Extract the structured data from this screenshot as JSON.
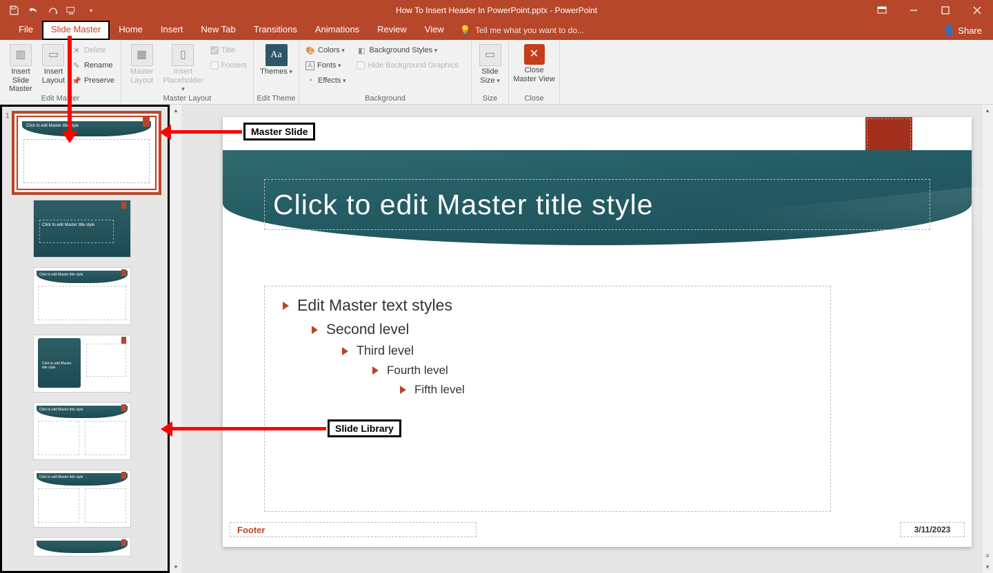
{
  "title": "How To Insert Header In PowerPoint.pptx - PowerPoint",
  "tabs": {
    "file": "File",
    "slide_master": "Slide Master",
    "home": "Home",
    "insert": "Insert",
    "new_tab": "New Tab",
    "transitions": "Transitions",
    "animations": "Animations",
    "review": "Review",
    "view": "View",
    "tellme": "Tell me what you want to do...",
    "share": "Share"
  },
  "ribbon": {
    "edit_master": {
      "insert_slide_master": "Insert Slide Master",
      "insert_layout": "Insert Layout",
      "delete": "Delete",
      "rename": "Rename",
      "preserve": "Preserve",
      "group": "Edit Master"
    },
    "master_layout": {
      "master_layout": "Master Layout",
      "insert_placeholder": "Insert Placeholder",
      "title_chk": "Title",
      "footers_chk": "Footers",
      "group": "Master Layout"
    },
    "edit_theme": {
      "themes": "Themes",
      "group": "Edit Theme"
    },
    "background": {
      "colors": "Colors",
      "fonts": "Fonts",
      "effects": "Effects",
      "bg_styles": "Background Styles",
      "hide_bg": "Hide Background Graphics",
      "group": "Background"
    },
    "size": {
      "slide_size": "Slide Size",
      "group": "Size"
    },
    "close": {
      "close_master": "Close Master View",
      "group": "Close"
    }
  },
  "slide": {
    "title_placeholder": "Click to edit Master title style",
    "levels": {
      "l1": "Edit Master text styles",
      "l2": "Second level",
      "l3": "Third level",
      "l4": "Fourth level",
      "l5": "Fifth level"
    },
    "number_placeholder": "‹#›",
    "footer_placeholder": "Footer",
    "date_placeholder": "3/11/2023"
  },
  "annotations": {
    "master_slide": "Master Slide",
    "slide_library": "Slide Library"
  },
  "thumbs": {
    "master_title": "Click to edit Master title style",
    "layout1_title": "Click to edit Master title style",
    "generic_title": "Click to edit Master title style",
    "section_title": "Click to edit Master title style"
  }
}
